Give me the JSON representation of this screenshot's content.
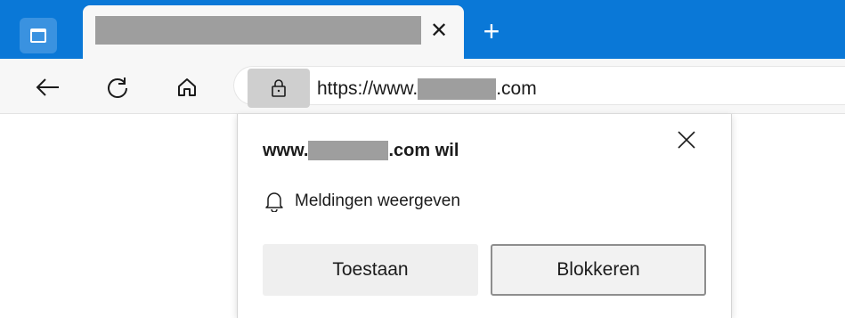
{
  "browser": {
    "tabstrip": {
      "tab": {
        "close_glyph": "✕"
      },
      "new_tab_glyph": "+"
    },
    "toolbar": {
      "icons": [
        "back-arrow-icon",
        "refresh-icon",
        "home-icon",
        "lock-icon"
      ],
      "address": {
        "prefix": "https://www.",
        "suffix": ".com"
      }
    }
  },
  "popup": {
    "title_prefix": "www.",
    "title_suffix": ".com wil",
    "permission_label": "Meldingen weergeven",
    "allow_label": "Toestaan",
    "block_label": "Blokkeren"
  },
  "colors": {
    "tabstrip": "#0a78d7",
    "toolbar": "#f7f7f7",
    "redaction": "#9e9e9e",
    "popup_bg": "#ffffff"
  }
}
